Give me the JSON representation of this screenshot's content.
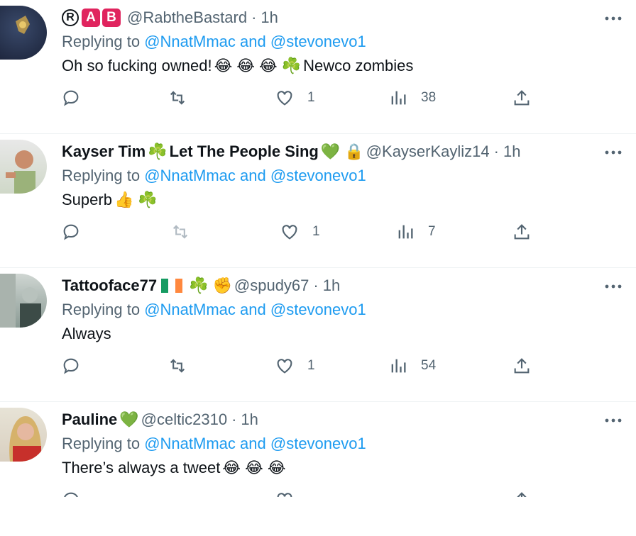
{
  "tweets": [
    {
      "name": "",
      "name_parts": [
        "R",
        "A",
        "B"
      ],
      "handle": "@RabtheBastard",
      "dot": "·",
      "time": "1h",
      "replying_prefix": "Replying to",
      "replying_to": "@NnatMmac",
      "replying_and": "and",
      "replying_to_2": "@stevonevo1",
      "text": "Oh so fucking owned! ",
      "text_emojis": [
        "😂",
        "😂",
        "😂",
        "☘️"
      ],
      "text_suffix": "Newco zombies",
      "stats": {
        "reply": "",
        "retweet": "",
        "likes": "1",
        "views": "38"
      }
    },
    {
      "name": "Kayser Tim",
      "name_emoji": "☘️",
      "name_suffix": "Let The People Sing",
      "name_emoji_2": "💚",
      "name_emoji_3": "🔒",
      "handle": "@KayserKayliz14",
      "dot": "·",
      "time": "1h",
      "replying_prefix": "Replying to",
      "replying_to": "@NnatMmac",
      "replying_and": "and",
      "replying_to_2": "@stevonevo1",
      "text": "Superb ",
      "text_emojis": [
        "👍",
        "☘️"
      ],
      "stats": {
        "likes": "1",
        "views": "7"
      }
    },
    {
      "name": "Tattooface77",
      "name_emoji_flag": "ireland-flag",
      "name_emoji": "☘️",
      "name_emoji_2": "✊",
      "handle": "@spudy67",
      "dot": "·",
      "time": "1h",
      "replying_prefix": "Replying to",
      "replying_to": "@NnatMmac",
      "replying_and": "and",
      "replying_to_2": "@stevonevo1",
      "text": "Always",
      "stats": {
        "likes": "1",
        "views": "54"
      }
    },
    {
      "name": "Pauline",
      "name_emoji": "💚",
      "handle": "@celtic2310",
      "dot": "·",
      "time": "1h",
      "replying_prefix": "Replying to",
      "replying_to": "@NnatMmac",
      "replying_and": "and",
      "replying_to_2": "@stevonevo1",
      "text": "There’s always a tweet ",
      "text_emojis": [
        "😂",
        "😂",
        "😂"
      ]
    }
  ],
  "colors": {
    "link": "#1d9bf0",
    "muted": "#536471",
    "text": "#0f1419",
    "badge": "#e0245e"
  },
  "icons": [
    "reply-icon",
    "retweet-icon",
    "like-icon",
    "views-icon",
    "share-icon",
    "more-icon"
  ]
}
